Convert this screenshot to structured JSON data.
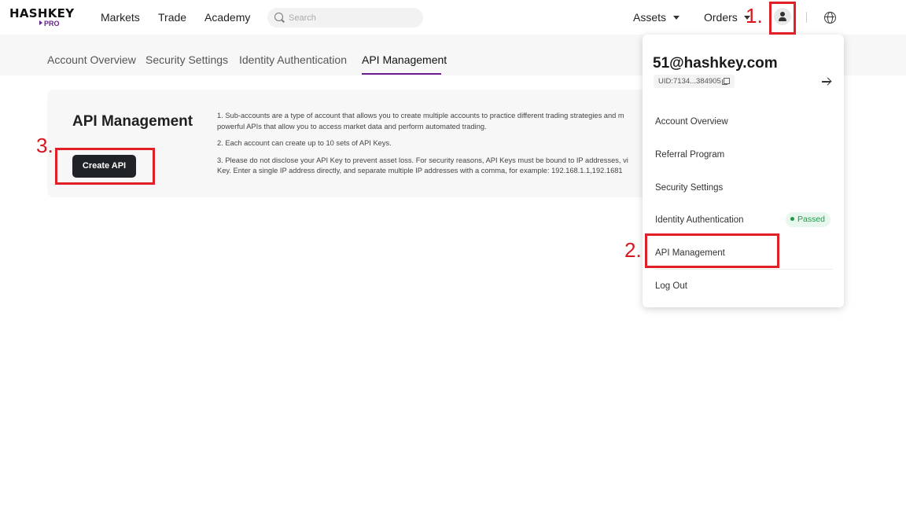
{
  "header": {
    "logo_main": "HASHKEY",
    "logo_sub": "PRO",
    "nav": [
      "Markets",
      "Trade",
      "Academy"
    ],
    "search_placeholder": "Search",
    "assets_label": "Assets",
    "orders_label": "Orders"
  },
  "tabs": [
    {
      "label": "Account Overview",
      "active": false
    },
    {
      "label": "Security Settings",
      "active": false
    },
    {
      "label": "Identity Authentication",
      "active": false
    },
    {
      "label": "API Management",
      "active": true
    }
  ],
  "card": {
    "title": "API Management",
    "create_button": "Create API",
    "notes": [
      "1. Sub-accounts are a type of account that allows you to create multiple accounts to practice different trading strategies and m",
      "powerful APIs that allow you to access market data and perform automated trading.",
      "2. Each account can create up to 10 sets of API Keys.",
      "3. Please do not disclose your API Key to prevent asset loss. For security reasons, API Keys must be bound to IP addresses, vi",
      "Key. Enter a single IP address directly, and separate multiple IP addresses with a comma, for example: 192.168.1.1,192.1681"
    ]
  },
  "dropdown": {
    "email": "51@hashkey.com",
    "uid": "UID:7134...384905",
    "items": [
      "Account Overview",
      "Referral Program",
      "Security Settings",
      "Identity Authentication",
      "API Management",
      "Log Out"
    ],
    "passed_badge": "Passed"
  },
  "annotations": [
    "1.",
    "2.",
    "3."
  ],
  "colors": {
    "brand_purple": "#6b1f8f",
    "annotation_red": "#e01f26",
    "button_dark": "#1f2226",
    "passed_green": "#1f9a4b"
  },
  "icons": [
    "search-icon",
    "user-icon",
    "globe-icon",
    "copy-icon",
    "arrow-right-icon",
    "chevron-down-icon"
  ]
}
